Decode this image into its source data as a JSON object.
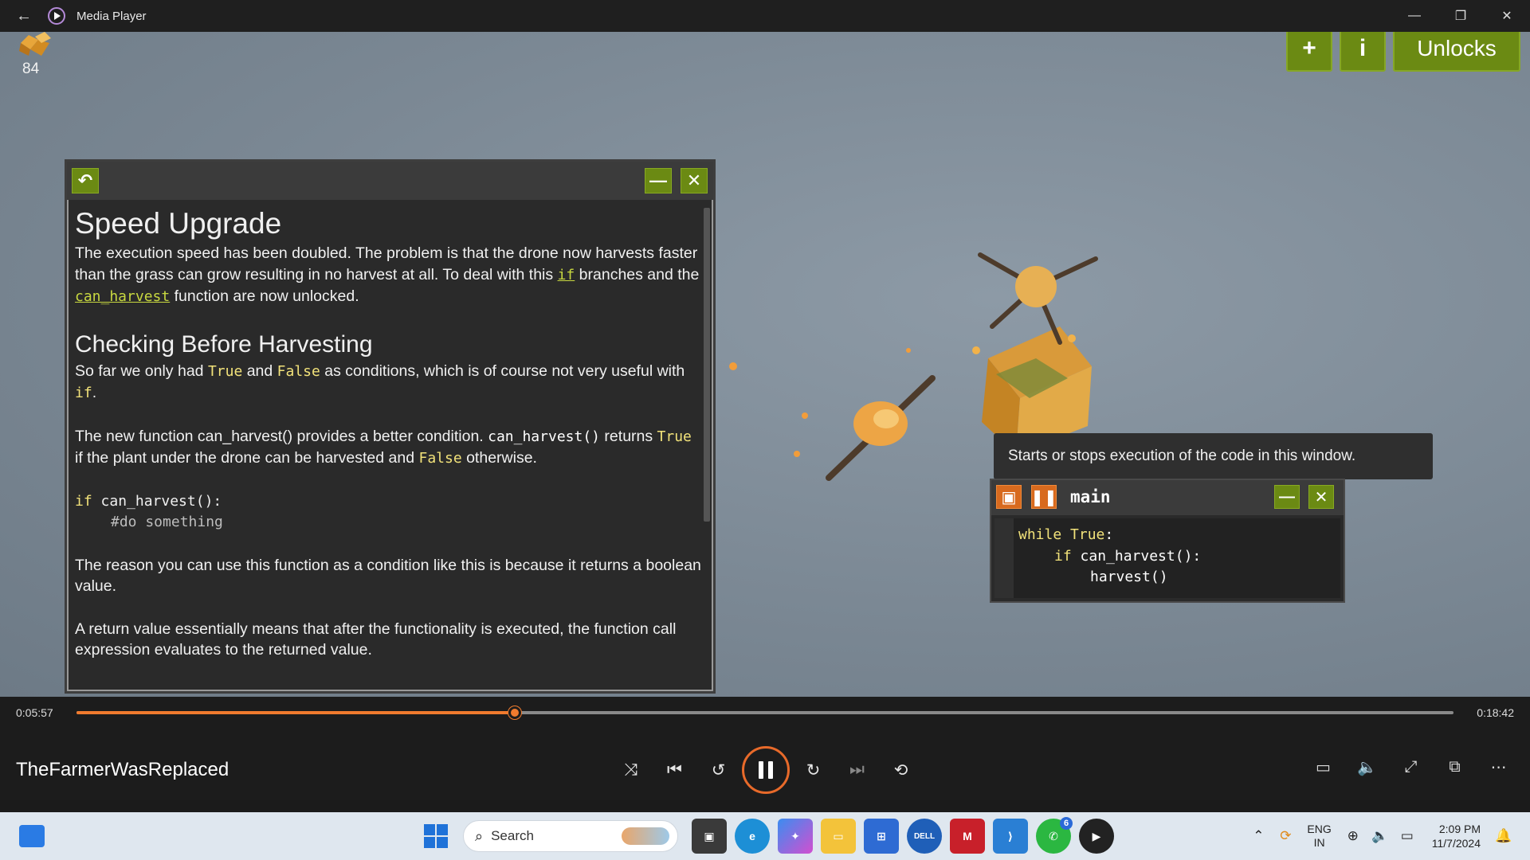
{
  "window": {
    "title": "Media Player"
  },
  "game": {
    "resource_count": "84",
    "buttons": {
      "add": "+",
      "info": "i",
      "unlocks": "Unlocks"
    }
  },
  "info_panel": {
    "heading1": "Speed Upgrade",
    "p1_a": "The execution speed has been doubled. The problem is that the drone now harvests faster than the grass can grow resulting in no harvest at all. To deal with this ",
    "p1_if": "if",
    "p1_b": " branches and the ",
    "p1_fn": "can_harvest",
    "p1_c": " function are now unlocked.",
    "heading2": "Checking Before Harvesting",
    "p2_a": "So far we only had ",
    "p2_true": "True",
    "p2_and": " and ",
    "p2_false": "False",
    "p2_b": " as conditions, which is of course not very useful with ",
    "p2_if": "if",
    "p2_c": ".",
    "p3_a": "The new function can_harvest() provides a better condition. ",
    "p3_code": "can_harvest()",
    "p3_b": " returns ",
    "p3_true": "True",
    "p3_c": " if the plant under the drone can be harvested and ",
    "p3_false": "False",
    "p3_d": " otherwise.",
    "code_if": "if",
    "code_rest": " can_harvest():",
    "code_comment": "#do something",
    "p4": "The reason you can use this function as a condition like this is because it returns a boolean value.",
    "p5": "A return value essentially means that after the functionality is executed, the function call expression evaluates to the returned value."
  },
  "tooltip": {
    "text": "Starts or stops execution of the code in this window."
  },
  "code_window": {
    "name": "main",
    "line1_kw": "while",
    "line1_kw2": "True",
    "line1_rest": ":",
    "line2_kw": "if",
    "line2_rest": " can_harvest():",
    "line3": "harvest()"
  },
  "player": {
    "current_time": "0:05:57",
    "total_time": "0:18:42",
    "progress": 0.318,
    "media_title": "TheFarmerWasReplaced",
    "accent": "#f07b2e"
  },
  "taskbar": {
    "search_placeholder": "Search",
    "whatsapp_badge": "6",
    "lang_line1": "ENG",
    "lang_line2": "IN",
    "time": "2:09 PM",
    "date": "11/7/2024"
  }
}
